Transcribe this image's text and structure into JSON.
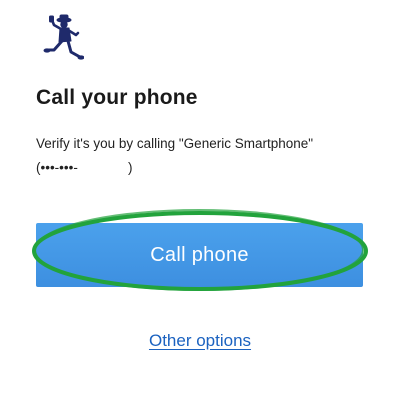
{
  "logo": {
    "icon": "runner-with-phone-logo-icon",
    "color": "#1f2a6b"
  },
  "title": "Call your phone",
  "description": {
    "text": "Verify it's you by calling \"Generic Smartphone\"",
    "masked_number_prefix": "(•••-•••-",
    "masked_number_suffix": ")"
  },
  "call_button": {
    "label": "Call phone",
    "color": "#4299e6",
    "highlight_color": "#22a33c"
  },
  "other_options": {
    "label": "Other options",
    "color": "#1b62c0"
  }
}
